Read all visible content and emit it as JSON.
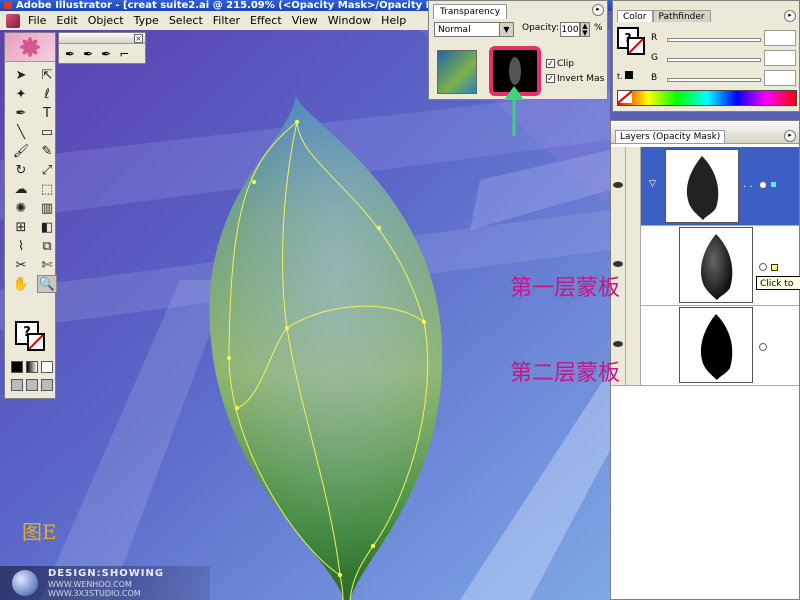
{
  "window": {
    "title": "Adobe Illustrator - [creat suite2.ai @ 215.09% (<Opacity Mask>/Opacity Mas"
  },
  "menu": {
    "items": [
      "File",
      "Edit",
      "Object",
      "Type",
      "Select",
      "Filter",
      "Effect",
      "View",
      "Window",
      "Help"
    ]
  },
  "transparency_panel": {
    "title": "Transparency",
    "blend_mode": "Normal",
    "opacity_label": "Opacity:",
    "opacity_value": "100",
    "opacity_unit": "%",
    "clip_label": "Clip",
    "invert_label": "Invert Mas",
    "clip_checked": true,
    "invert_checked": true,
    "highlight_color": "#e1306c",
    "arrow_color": "#3cd67a"
  },
  "color_panel": {
    "tabs": [
      "Color",
      "Pathfinder"
    ],
    "channels": [
      "R",
      "G",
      "B"
    ]
  },
  "layers_panel": {
    "title": "Layers (Opacity Mask)",
    "tooltip": "Click to"
  },
  "annotations": {
    "mask_layer_1": "第一层蒙板",
    "mask_layer_2": "第二层蒙板",
    "figure_label": "图E",
    "label_color": "#c71585",
    "figure_color": "#e0b020"
  },
  "watermark": {
    "line1": "DESIGN:SHOWING",
    "line2": "WWW.WENHOO.COM",
    "line3": "WWW.3X3STUDIO.COM"
  }
}
